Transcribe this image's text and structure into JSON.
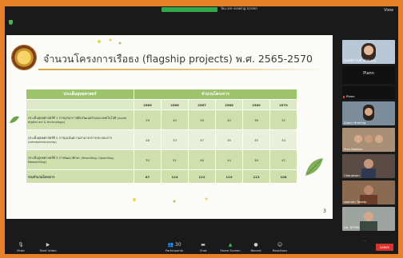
{
  "top": {
    "sharing_label": "You are viewing screen",
    "view_label": "View"
  },
  "slide": {
    "title": "จำนวนโครงการเรือธง (flagship projects) พ.ศ. 2565-2570",
    "page_number": "3",
    "table": {
      "col_strategy": "ประเด็นยุทธศาสตร์",
      "col_projects": "จำนวนโครงการ",
      "years": [
        "2565",
        "2566",
        "2567",
        "2568",
        "2569",
        "2570"
      ],
      "rows": [
        {
          "label": "ประเด็นยุทธศาสตร์ที่ 1 การบูรณาการศิลปวัฒนธรรมและเทคโนโลยี (novel digital art & technology)",
          "values": [
            "29",
            "40",
            "39",
            "40",
            "36",
            "32"
          ]
        },
        {
          "label": "ประเด็นยุทธศาสตร์ที่ 2 การมุ่งเน้นความสามารถการประกอบการ (entrepreneurship)",
          "values": [
            "28",
            "33",
            "37",
            "35",
            "35",
            "34"
          ]
        },
        {
          "label": "ประเด็นยุทธศาสตร์ที่ 3 การพัฒนาทักษะ (Reskilling, Upskilling, Newskilling)",
          "values": [
            "30",
            "51",
            "46",
            "44",
            "46",
            "42"
          ]
        }
      ],
      "total_label": "รวมจำนวนโครงการ",
      "totals": [
        "87",
        "124",
        "122",
        "119",
        "113",
        "108"
      ]
    }
  },
  "participants": [
    {
      "name": "รองอธิการบดี (ฝ่ายแผน)"
    },
    {
      "name": "Plann"
    },
    {
      "name": "Plann"
    },
    {
      "name": "Zoom Meeting"
    },
    {
      "name": "Plan Nakhon"
    },
    {
      "name": "Chanatorn"
    },
    {
      "name": "ssamdn Tavatp"
    },
    {
      "name": "นพ. สุวรรณ"
    }
  ],
  "toolbar": {
    "mute": "Mute",
    "video": "Start Video",
    "participants": "Participants",
    "participants_count": "30",
    "chat": "Chat",
    "share": "Share Screen",
    "record": "Record",
    "reactions": "Reactions",
    "leave": "Leave"
  }
}
